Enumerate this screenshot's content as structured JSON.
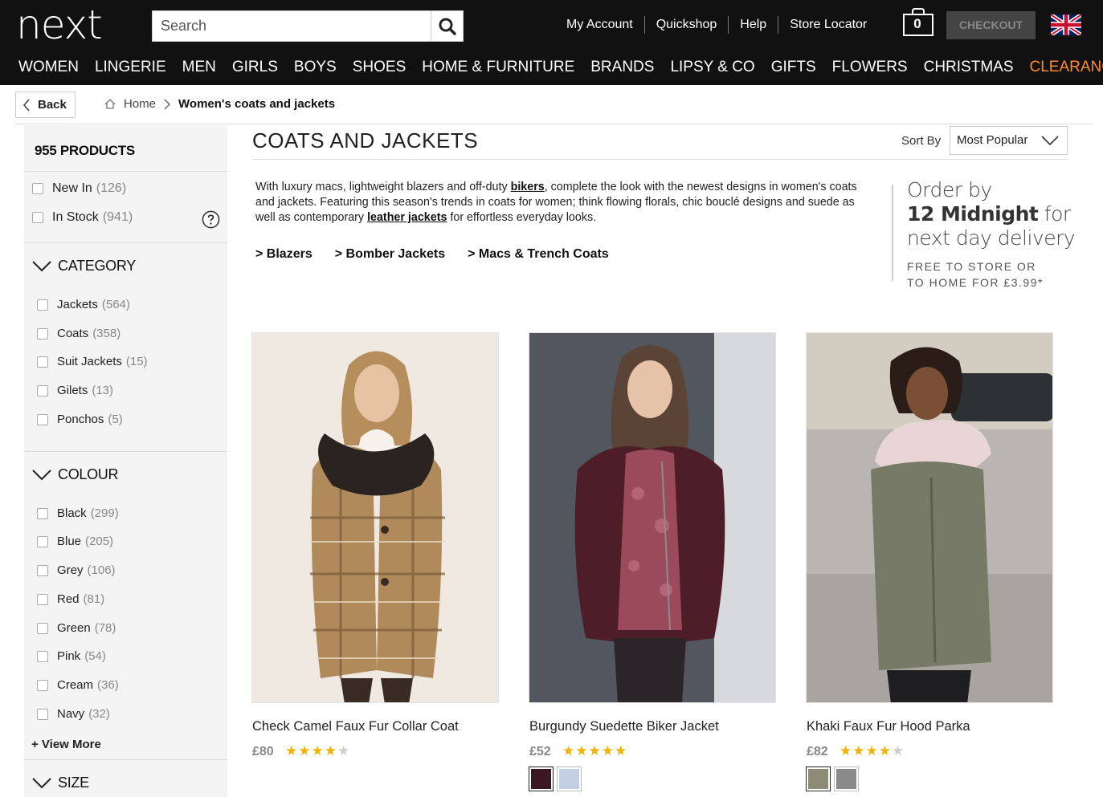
{
  "header": {
    "logo": "next",
    "search_placeholder": "Search",
    "links": [
      "My Account",
      "Quickshop",
      "Help",
      "Store Locator"
    ],
    "bag_count": "0",
    "checkout_label": "CHECKOUT",
    "nav": [
      "WOMEN",
      "LINGERIE",
      "MEN",
      "GIRLS",
      "BOYS",
      "SHOES",
      "HOME & FURNITURE",
      "BRANDS",
      "LIPSY & CO",
      "GIFTS",
      "FLOWERS",
      "CHRISTMAS",
      "CLEARANCE"
    ],
    "clearance_color": "#ff8c2b"
  },
  "breadcrumb": {
    "back_label": "Back",
    "home": "Home",
    "current": "Women's coats and jackets"
  },
  "sidebar": {
    "product_count": "955 PRODUCTS",
    "toggles": [
      {
        "label": "New In",
        "count": "(126)"
      },
      {
        "label": "In Stock",
        "count": "(941)"
      }
    ],
    "category": {
      "title": "CATEGORY",
      "items": [
        {
          "label": "Jackets",
          "count": "(564)"
        },
        {
          "label": "Coats",
          "count": "(358)"
        },
        {
          "label": "Suit Jackets",
          "count": "(15)"
        },
        {
          "label": "Gilets",
          "count": "(13)"
        },
        {
          "label": "Ponchos",
          "count": "(5)"
        }
      ]
    },
    "colour": {
      "title": "COLOUR",
      "items": [
        {
          "label": "Black",
          "count": "(299)"
        },
        {
          "label": "Blue",
          "count": "(205)"
        },
        {
          "label": "Grey",
          "count": "(106)"
        },
        {
          "label": "Red",
          "count": "(81)"
        },
        {
          "label": "Green",
          "count": "(78)"
        },
        {
          "label": "Pink",
          "count": "(54)"
        },
        {
          "label": "Cream",
          "count": "(36)"
        },
        {
          "label": "Navy",
          "count": "(32)"
        }
      ],
      "view_more": "+ View More"
    },
    "size_title": "SIZE"
  },
  "main": {
    "title": "COATS AND JACKETS",
    "sort_label": "Sort By",
    "sort_value": "Most Popular",
    "description": {
      "p1": "With luxury macs, lightweight blazers and off-duty ",
      "link1": "bikers",
      "p2": ", complete the look with the newest designs in women's coats and jackets. Featuring this season's trends in coats for women; think flowing florals, chic bouclé designs and suede as well as contemporary ",
      "link2": "leather jackets",
      "p3": " for effortless everyday looks."
    },
    "sublinks": [
      "> Blazers",
      "> Bomber Jackets",
      "> Macs & Trench Coats"
    ],
    "promo": {
      "line1": "Order by",
      "line2_bold": "12 Midnight",
      "line2_rest": " for",
      "line3": "next day delivery",
      "line4": "FREE TO STORE OR",
      "line5": "TO HOME FOR £3.99*"
    }
  },
  "products": [
    {
      "name": "Check Camel Faux Fur Collar Coat",
      "price": "£80",
      "rating": 4,
      "swatches": []
    },
    {
      "name": "Burgundy Suedette Biker Jacket",
      "price": "£52",
      "rating": 5,
      "swatches": [
        "#3a1722",
        "#c3cfe2"
      ]
    },
    {
      "name": "Khaki Faux Fur Hood Parka",
      "price": "£82",
      "rating": 4,
      "swatches": [
        "#8d8a76",
        "#8a8a8a"
      ]
    }
  ]
}
